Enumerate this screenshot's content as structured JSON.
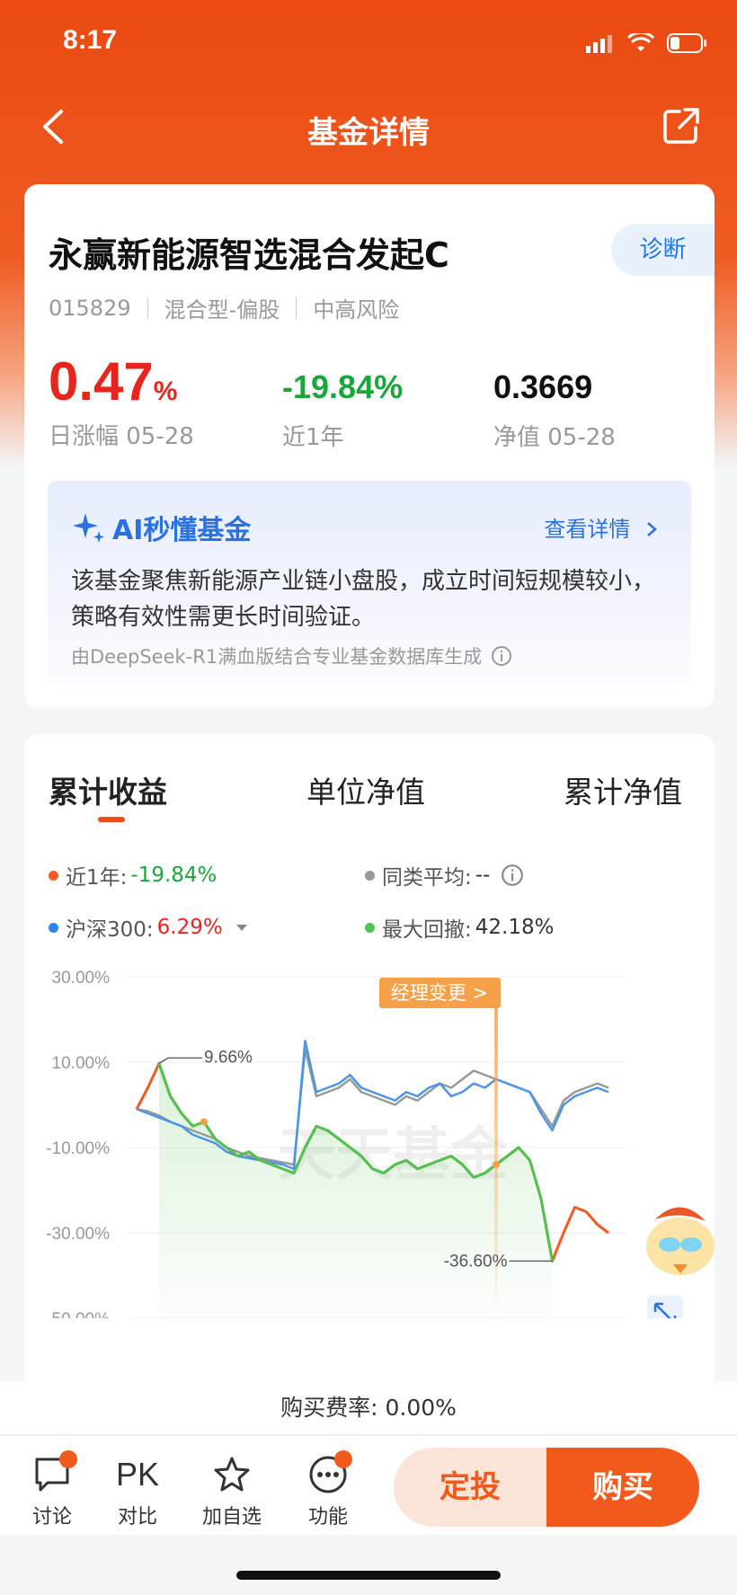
{
  "status": {
    "time": "8:17"
  },
  "nav": {
    "title": "基金详情"
  },
  "fund": {
    "name": "永赢新能源智选混合发起C",
    "code": "015829",
    "type": "混合型-偏股",
    "risk": "中高风险",
    "diagnose": "诊断",
    "daily_change": "0.47",
    "daily_change_unit": "%",
    "daily_label": "日涨幅 05-28",
    "year_change": "-19.84%",
    "year_label": "近1年",
    "nav_value": "0.3669",
    "nav_label": "净值 05-28"
  },
  "ai": {
    "title": "AI秒懂基金",
    "link": "查看详情",
    "text": "该基金聚焦新能源产业链小盘股，成立时间短规模较小，策略有效性需更长时间验证。",
    "note": "由DeepSeek-R1满血版结合专业基金数据库生成"
  },
  "tabs": [
    "累计收益",
    "单位净值",
    "累计净值"
  ],
  "legend": {
    "fund_label": "近1年:",
    "fund_value": "-19.84%",
    "peer_label": "同类平均:",
    "peer_value": "--",
    "index_label": "沪深300:",
    "index_value": "6.29%",
    "dd_label": "最大回撤:",
    "dd_value": "42.18%"
  },
  "chart_data": {
    "type": "line",
    "y_ticks": [
      "30.00%",
      "10.00%",
      "-10.00%",
      "-30.00%",
      "-50.00%"
    ],
    "ylim": [
      -50,
      30
    ],
    "annotations": {
      "peak": "9.66%",
      "trough": "-36.60%",
      "manager_change": "经理变更 >",
      "watermark": "天天基金"
    },
    "series": [
      {
        "name": "近1年",
        "color": "#f15a22",
        "values": [
          -1,
          4,
          9.7,
          2,
          -2,
          -5,
          -4,
          -8,
          -10,
          -12,
          -11,
          -13,
          -14,
          -15,
          -16,
          -10,
          -5,
          -6,
          -8,
          -10,
          -12,
          -15,
          -16,
          -14,
          -13,
          -15,
          -14,
          -13,
          -12,
          -14,
          -17,
          -16,
          -14,
          -12,
          -10,
          -13,
          -22,
          -36.6,
          -30,
          -24,
          -25,
          -28,
          -30
        ]
      },
      {
        "name": "沪深300",
        "color": "#4b95e9",
        "values": [
          -1,
          -2,
          -3,
          -4,
          -5,
          -7,
          -8,
          -9,
          -11,
          -12,
          -12.5,
          -13,
          -13.5,
          -14,
          -15,
          15,
          3,
          4,
          5,
          7,
          4,
          3,
          2,
          1,
          3,
          2,
          4,
          5,
          2,
          3,
          5,
          4,
          6,
          5,
          4,
          3,
          -2,
          -6,
          0,
          2,
          3,
          4,
          3
        ]
      },
      {
        "name": "同类平均",
        "color": "#999999",
        "values": [
          -1,
          -1.5,
          -2.5,
          -4,
          -5,
          -6,
          -7,
          -8,
          -10,
          -11,
          -12,
          -12.5,
          -13,
          -13.5,
          -14,
          13,
          2,
          3,
          4,
          6,
          3,
          2,
          1,
          0,
          2,
          1,
          3,
          5,
          4,
          6,
          8,
          7,
          6,
          5,
          4,
          3,
          -1,
          -5,
          1,
          3,
          4,
          5,
          4
        ]
      }
    ]
  },
  "fee": {
    "label": "购买费率: 0.00%"
  },
  "bottom": {
    "discuss": "讨论",
    "pk_icon": "PK",
    "compare": "对比",
    "watch": "加自选",
    "func": "功能",
    "dingtou": "定投",
    "buy": "购买"
  }
}
